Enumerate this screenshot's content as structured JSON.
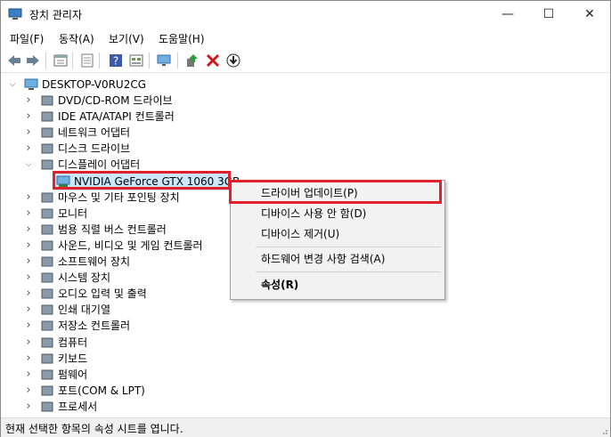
{
  "window": {
    "title": "장치 관리자"
  },
  "caption": {
    "minimize": "—",
    "maximize": "☐",
    "close": "✕"
  },
  "menu": [
    "파일(F)",
    "동작(A)",
    "보기(V)",
    "도움말(H)"
  ],
  "toolbar_icons": [
    "back-icon",
    "forward-icon",
    "properties-sheet-icon",
    "details-icon",
    "help-icon",
    "view-icon",
    "monitor-scan-icon",
    "update-driver-icon",
    "uninstall-icon",
    "download-icon"
  ],
  "tree": {
    "root": "DESKTOP-V0RU2CG",
    "items": [
      {
        "label": "DVD/CD-ROM 드라이브",
        "icon": "dvd-drive-icon",
        "expanded": false
      },
      {
        "label": "IDE ATA/ATAPI 컨트롤러",
        "icon": "ide-controller-icon",
        "expanded": false
      },
      {
        "label": "네트워크 어댑터",
        "icon": "network-adapter-icon",
        "expanded": false
      },
      {
        "label": "디스크 드라이브",
        "icon": "disk-drive-icon",
        "expanded": false
      },
      {
        "label": "디스플레이 어댑터",
        "icon": "display-adapter-icon",
        "expanded": true
      },
      {
        "label": "마우스 및 기타 포인팅 장치",
        "icon": "mouse-icon",
        "expanded": false
      },
      {
        "label": "모니터",
        "icon": "monitor-icon",
        "expanded": false
      },
      {
        "label": "범용 직렬 버스 컨트롤러",
        "icon": "usb-controller-icon",
        "expanded": false
      },
      {
        "label": "사운드, 비디오 및 게임 컨트롤러",
        "icon": "sound-icon",
        "expanded": false
      },
      {
        "label": "소프트웨어 장치",
        "icon": "software-device-icon",
        "expanded": false
      },
      {
        "label": "시스템 장치",
        "icon": "system-device-icon",
        "expanded": false
      },
      {
        "label": "오디오 입력 및 출력",
        "icon": "audio-io-icon",
        "expanded": false
      },
      {
        "label": "인쇄 대기열",
        "icon": "print-queue-icon",
        "expanded": false
      },
      {
        "label": "저장소 컨트롤러",
        "icon": "storage-controller-icon",
        "expanded": false
      },
      {
        "label": "컴퓨터",
        "icon": "computer-icon",
        "expanded": false
      },
      {
        "label": "키보드",
        "icon": "keyboard-icon",
        "expanded": false
      },
      {
        "label": "펌웨어",
        "icon": "firmware-icon",
        "expanded": false
      },
      {
        "label": "포트(COM & LPT)",
        "icon": "port-icon",
        "expanded": false
      },
      {
        "label": "프로세서",
        "icon": "processor-icon",
        "expanded": false
      }
    ],
    "selected_child": "NVIDIA GeForce GTX 1060 3GB"
  },
  "context_menu": {
    "update_driver": "드라이버 업데이트(P)",
    "disable_device": "디바이스 사용 안 함(D)",
    "uninstall_device": "디바이스 제거(U)",
    "scan_hardware": "하드웨어 변경 사항 검색(A)",
    "properties": "속성(R)"
  },
  "status": "현재 선택한 항목의 속성 시트를 엽니다.",
  "colors": {
    "highlight": "#e0202a",
    "selection": "#cce8ff",
    "menu_bg": "#f2f2f2"
  }
}
